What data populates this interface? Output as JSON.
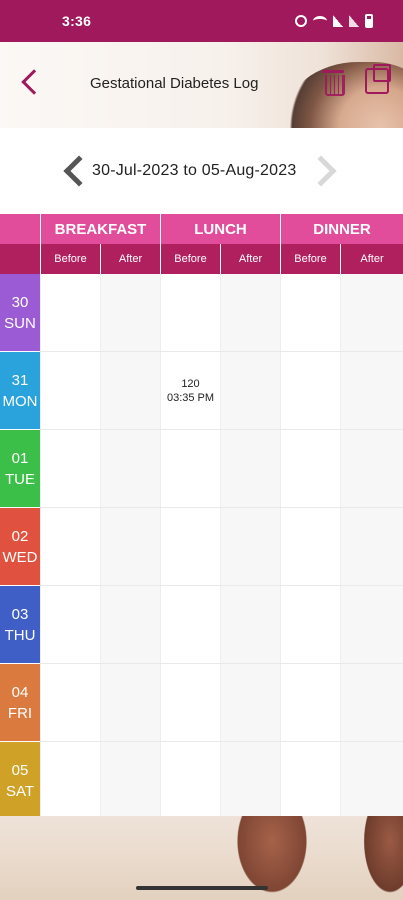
{
  "status_bar": {
    "time": "3:36",
    "icons": [
      "alarm-icon",
      "wifi-icon",
      "signal-icon",
      "signal-icon",
      "battery-icon"
    ]
  },
  "header": {
    "title": "Gestational Diabetes Log",
    "icons": [
      "back-chevron-icon",
      "trash-icon",
      "share-icon"
    ]
  },
  "date_nav": {
    "range": "30-Jul-2023 to 05-Aug-2023"
  },
  "table": {
    "meals": [
      {
        "label": "BREAKFAST",
        "before": "Before",
        "after": "After"
      },
      {
        "label": "LUNCH",
        "before": "Before",
        "after": "After"
      },
      {
        "label": "DINNER",
        "before": "Before",
        "after": "After"
      }
    ],
    "days": [
      {
        "num": "30",
        "name": "SUN",
        "color": "#9a5bd4",
        "cells": [
          "",
          "",
          "",
          "",
          "",
          ""
        ]
      },
      {
        "num": "31",
        "name": "MON",
        "color": "#2aa3dc",
        "cells": [
          "",
          "",
          "120|03:35 PM",
          "",
          "",
          ""
        ]
      },
      {
        "num": "01",
        "name": "TUE",
        "color": "#3cbf48",
        "cells": [
          "",
          "",
          "",
          "",
          "",
          ""
        ]
      },
      {
        "num": "02",
        "name": "WED",
        "color": "#e0523f",
        "cells": [
          "",
          "",
          "",
          "",
          "",
          ""
        ]
      },
      {
        "num": "03",
        "name": "THU",
        "color": "#3f5fc6",
        "cells": [
          "",
          "",
          "",
          "",
          "",
          ""
        ]
      },
      {
        "num": "04",
        "name": "FRI",
        "color": "#db7a3f",
        "cells": [
          "",
          "",
          "",
          "",
          "",
          ""
        ]
      },
      {
        "num": "05",
        "name": "SAT",
        "color": "#cfa127",
        "cells": [
          "",
          "",
          "",
          "",
          "",
          ""
        ]
      }
    ],
    "lunch_before_mon": {
      "value": "120",
      "time": "03:35 PM"
    }
  }
}
